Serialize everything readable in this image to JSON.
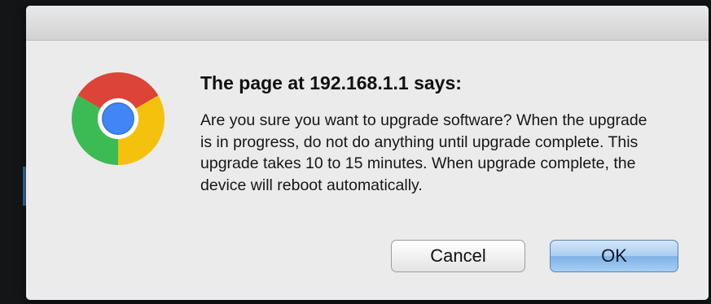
{
  "dialog": {
    "icon": "chrome-logo-icon",
    "title": "The page at 192.168.1.1 says:",
    "message": "Are you sure you want to upgrade software? When the upgrade is in progress, do not do anything until upgrade complete. This upgrade takes 10 to 15 minutes. When upgrade complete, the device will reboot automatically.",
    "buttons": {
      "cancel_label": "Cancel",
      "ok_label": "OK"
    }
  },
  "colors": {
    "dialog_background": "#ebebeb",
    "default_button": "#a9cdf1",
    "backdrop": "#141517"
  }
}
